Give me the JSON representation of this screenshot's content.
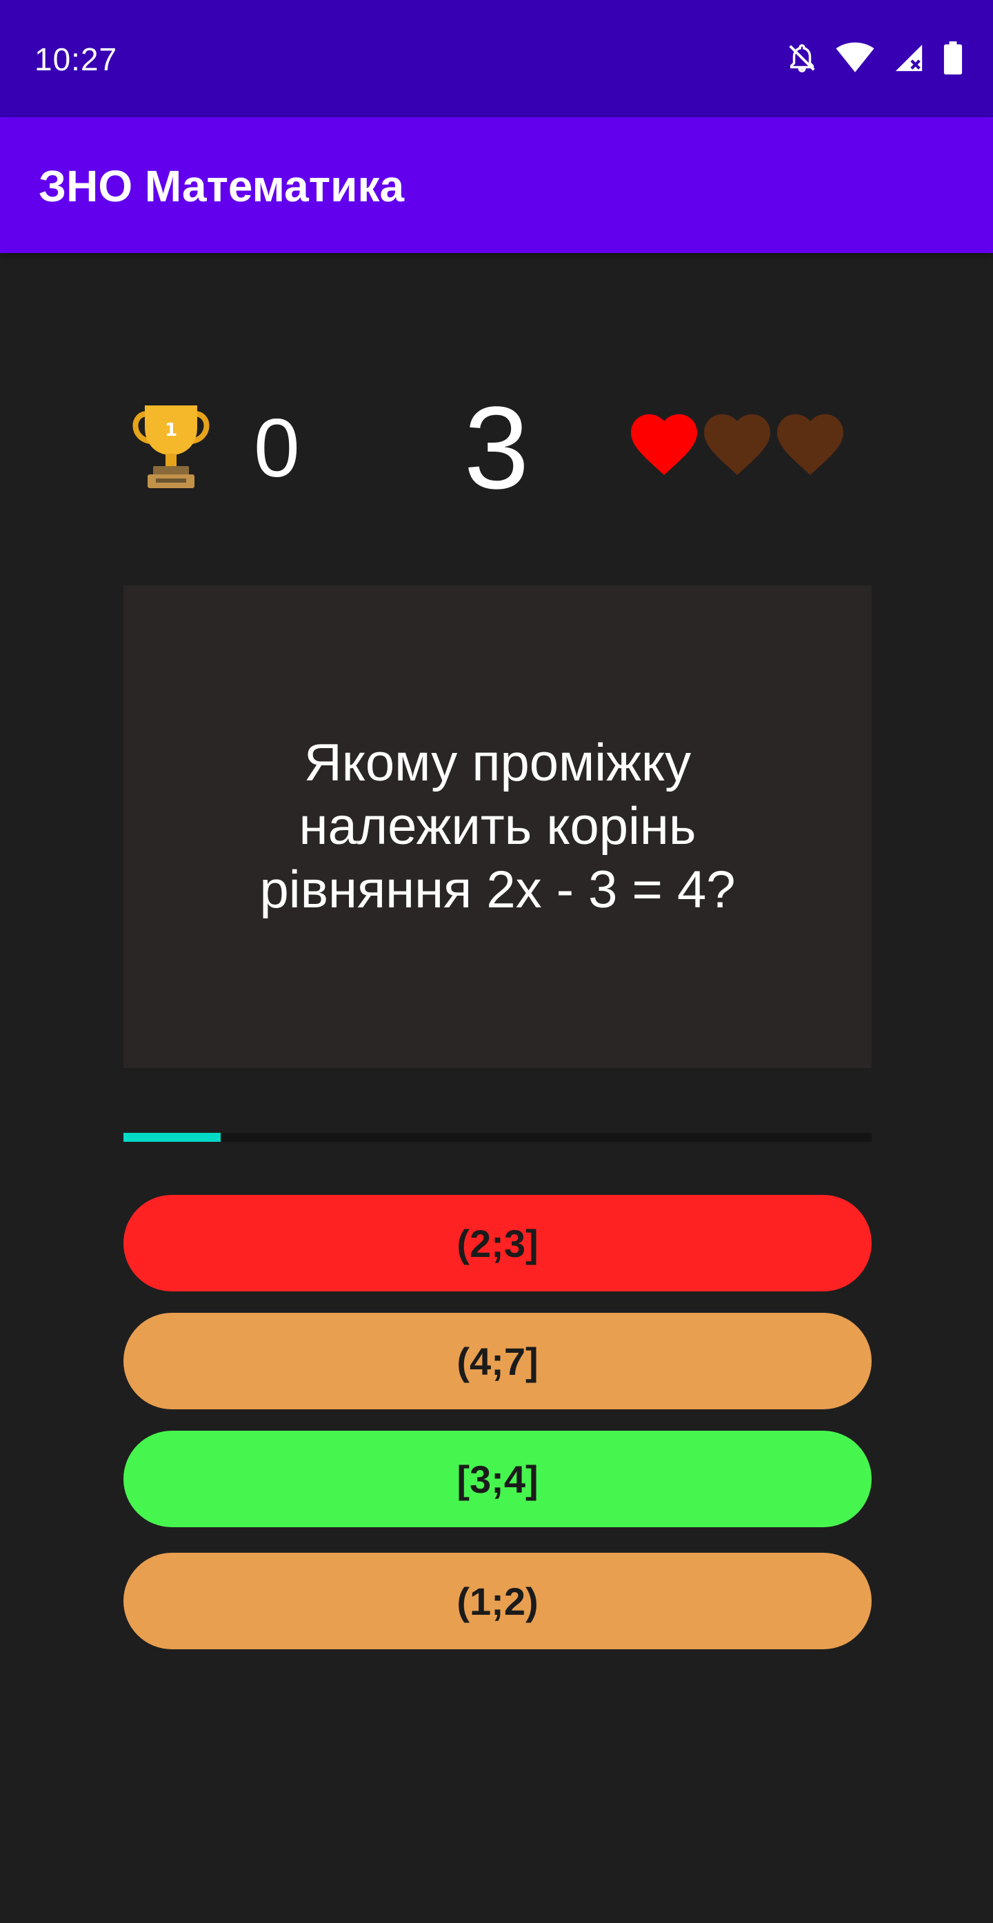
{
  "status_bar": {
    "time": "10:27",
    "icons": [
      "notifications-off-icon",
      "wifi-icon",
      "signal-no-data-icon",
      "battery-icon"
    ]
  },
  "app_bar": {
    "title": "ЗНО Математика"
  },
  "scoreboard": {
    "trophy_icon": "trophy-icon",
    "score": "0",
    "counter": "3",
    "lives_total": 3,
    "lives_remaining": 1,
    "heart_active_color": "#ff0000",
    "heart_lost_color": "#5c2e12"
  },
  "question": {
    "text": "Якому проміжку належить корінь рівняння 2x - 3 = 4?"
  },
  "progress": {
    "fraction": 0.13,
    "fill_color": "#03dac5"
  },
  "answers": [
    {
      "label": "(2;3]",
      "state": "wrong",
      "color": "#ff2222"
    },
    {
      "label": "(4;7]",
      "state": "default",
      "color": "#e89f50"
    },
    {
      "label": "[3;4]",
      "state": "correct",
      "color": "#47f54f"
    },
    {
      "label": "(1;2)",
      "state": "default",
      "color": "#e89f50"
    }
  ],
  "colors": {
    "status_bar": "#3700b3",
    "app_bar": "#6200ee",
    "background": "#1f1e1e",
    "card": "#292625"
  }
}
